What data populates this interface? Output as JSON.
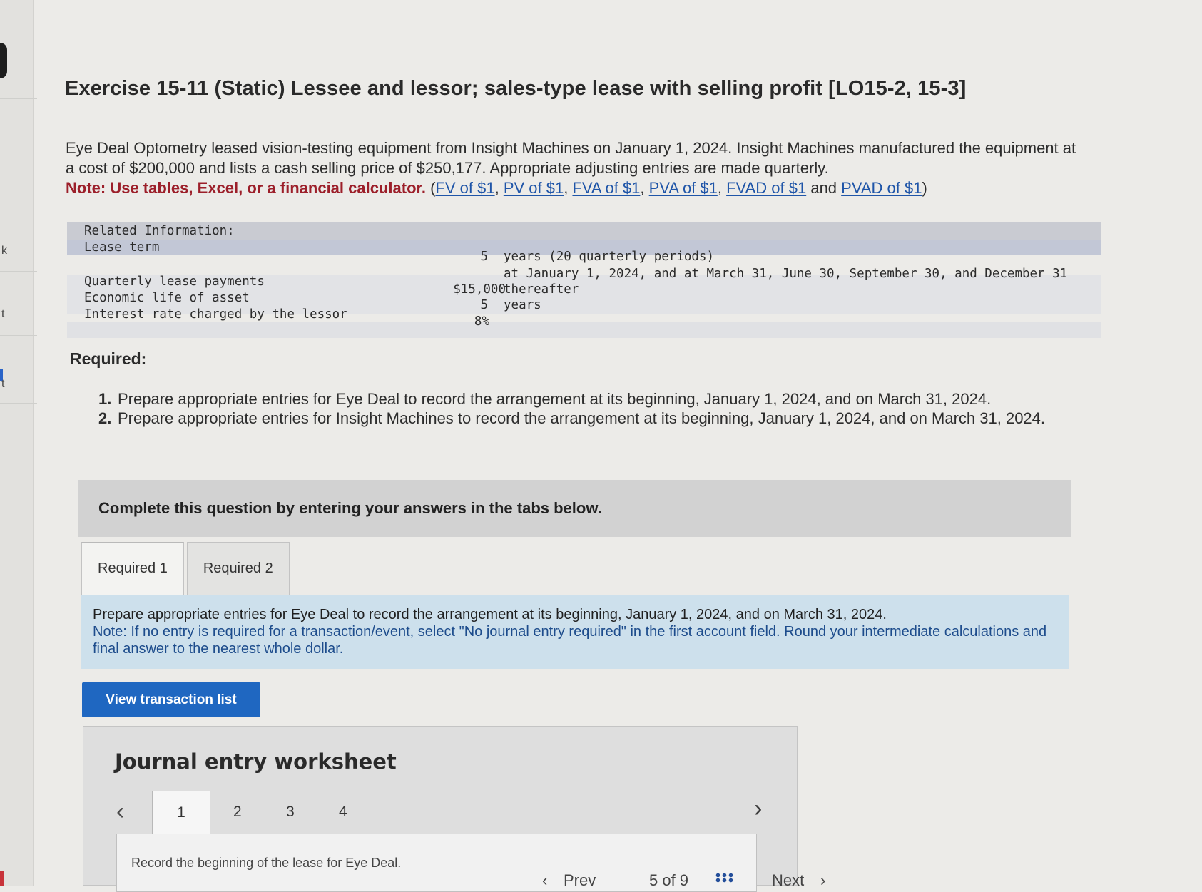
{
  "title": "Exercise 15-11 (Static) Lessee and lessor; sales-type lease with selling profit [LO15-2, 15-3]",
  "intro": {
    "text": "Eye Deal Optometry leased vision-testing equipment from Insight Machines on January 1, 2024. Insight Machines manufactured the equipment at a cost of $200,000 and lists a cash selling price of $250,177. Appropriate adjusting entries are made quarterly.",
    "note": "Note: Use tables, Excel, or a financial calculator.",
    "links": [
      "FV of $1",
      "PV of $1",
      "FVA of $1",
      "PVA of $1",
      "FVAD of $1",
      "PVAD of $1"
    ],
    "and_word": "and"
  },
  "related": {
    "header": "Related Information:",
    "rows": [
      {
        "label": "Lease term",
        "value": "5",
        "unit": "years (20 quarterly periods)"
      },
      {
        "label": "Quarterly lease payments",
        "value": "$15,000",
        "unit_line1": "at January 1, 2024, and at March 31, June 30, September 30, and December 31",
        "unit_line2": "thereafter"
      },
      {
        "label": "Economic life of asset",
        "value": "5",
        "unit": "years"
      },
      {
        "label": "Interest rate charged by the lessor",
        "value": "8%",
        "unit": ""
      }
    ]
  },
  "required": {
    "heading": "Required:",
    "items": [
      "Prepare appropriate entries for Eye Deal to record the arrangement at its beginning, January 1, 2024, and on March 31, 2024.",
      "Prepare appropriate entries for Insight Machines to record the arrangement at its beginning, January 1, 2024, and on March 31, 2024."
    ]
  },
  "complete_box": "Complete this question by entering your answers in the tabs below.",
  "tabs": [
    {
      "label": "Required 1",
      "active": true
    },
    {
      "label": "Required 2",
      "active": false
    }
  ],
  "instructions": {
    "text": "Prepare appropriate entries for Eye Deal to record the arrangement at its beginning, January 1, 2024, and on March 31, 2024.",
    "note": "Note: If no entry is required for a transaction/event, select \"No journal entry required\" in the first account field. Round your intermediate calculations and final answer to the nearest whole dollar."
  },
  "view_button": "View transaction list",
  "worksheet": {
    "title": "Journal entry worksheet",
    "pages": [
      "1",
      "2",
      "3",
      "4"
    ],
    "active_page": "1",
    "prev_icon": "chevron-left-icon",
    "next_icon": "chevron-right-icon",
    "instruction": "Record the beginning of the lease for Eye Deal."
  },
  "footer_nav": {
    "prev": "Prev",
    "position": "5 of 9",
    "next": "Next",
    "grid_icon": "grid-icon"
  },
  "left_stubs": [
    "k",
    "t",
    "t"
  ],
  "colors": {
    "accent_blue": "#1f67c1",
    "note_red": "#9c1f2a",
    "link_blue": "#1f55a8",
    "instruction_bg": "#cde0ec"
  }
}
